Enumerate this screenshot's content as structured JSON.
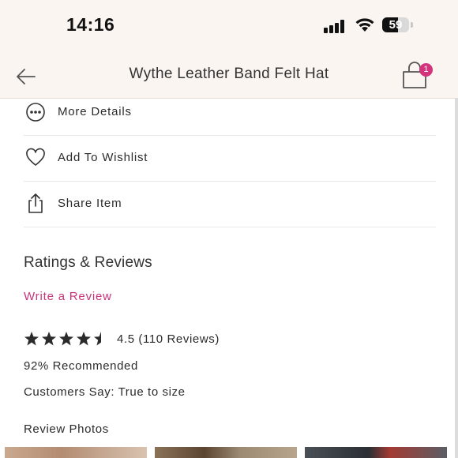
{
  "status_bar": {
    "time": "14:16",
    "battery": "59",
    "battery_level": 0.59
  },
  "nav": {
    "title": "Wythe Leather Band Felt Hat",
    "cart_count": "1"
  },
  "menu": [
    {
      "label": "More Details",
      "icon": "more-dots-icon"
    },
    {
      "label": "Add To Wishlist",
      "icon": "heart-icon"
    },
    {
      "label": "Share Item",
      "icon": "share-icon"
    }
  ],
  "reviews": {
    "title": "Ratings & Reviews",
    "write_review": "Write a Review",
    "rating": 4.5,
    "rating_text": "4.5 (110 Reviews)",
    "recommended": "92% Recommended",
    "customers_say": "Customers Say: True to size",
    "photos_title": "Review Photos"
  },
  "colors": {
    "accent": "#c8347a",
    "badge": "#d2337a",
    "header_bg": "#fbf5f1"
  }
}
